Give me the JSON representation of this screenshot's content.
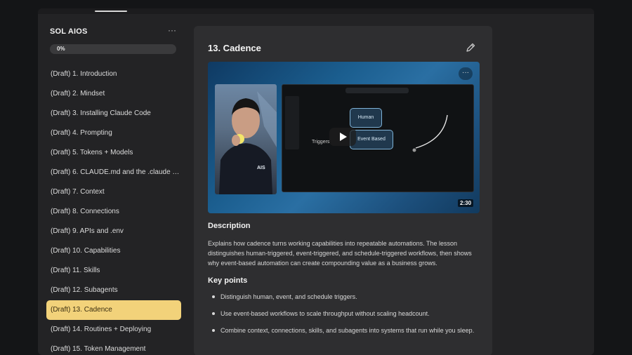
{
  "sidebar": {
    "course_title": "SOL AIOS",
    "more_label": "···",
    "progress_label": "0%",
    "progress_value": 0,
    "lessons": [
      {
        "label": "(Draft) 1. Introduction"
      },
      {
        "label": "(Draft) 2. Mindset"
      },
      {
        "label": "(Draft) 3. Installing Claude Code"
      },
      {
        "label": "(Draft) 4. Prompting"
      },
      {
        "label": "(Draft) 5. Tokens + Models"
      },
      {
        "label": "(Draft) 6. CLAUDE.md and the .claude Fol..."
      },
      {
        "label": "(Draft) 7. Context"
      },
      {
        "label": "(Draft) 8. Connections"
      },
      {
        "label": "(Draft) 9. APIs and .env"
      },
      {
        "label": "(Draft) 10. Capabilities"
      },
      {
        "label": "(Draft) 11. Skills"
      },
      {
        "label": "(Draft) 12. Subagents"
      },
      {
        "label": "(Draft) 13. Cadence"
      },
      {
        "label": "(Draft) 14. Routines + Deploying"
      },
      {
        "label": "(Draft) 15. Token Management"
      }
    ],
    "active_index": 12,
    "active_color": "#f2d27a"
  },
  "lesson": {
    "title": "13. Cadence",
    "video": {
      "menu_label": "···",
      "duration": "2:30",
      "node_human": "Human",
      "node_event": "Event Based",
      "triggers_label": "Triggers",
      "shirt_logo": "AIS"
    },
    "description_heading": "Description",
    "description": "Explains how cadence turns working capabilities into repeatable automations. The lesson distinguishes human-triggered, event-triggered, and schedule-triggered workflows, then shows why event-based automation can create compounding value as a business grows.",
    "key_points_heading": "Key points",
    "key_points": [
      "Distinguish human, event, and schedule triggers.",
      "Use event-based workflows to scale throughput without scaling headcount.",
      "Combine context, connections, skills, and subagents into systems that run while you sleep."
    ]
  }
}
